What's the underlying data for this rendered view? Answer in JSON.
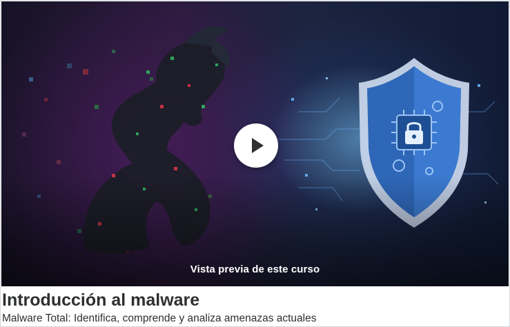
{
  "preview": {
    "label": "Vista previa de este curso",
    "play_icon": "play-icon",
    "illustration": {
      "subject_left": "dragon-icon",
      "subject_right": "shield-lock-icon"
    }
  },
  "course": {
    "title": "Introducción al malware",
    "subtitle": "Malware Total: Identifica, comprende y analiza amenazas actuales"
  },
  "colors": {
    "text": "#2d2f31",
    "play_button": "#ffffff",
    "shield_blue": "#3f7fd6",
    "border": "#d1d7dc"
  }
}
